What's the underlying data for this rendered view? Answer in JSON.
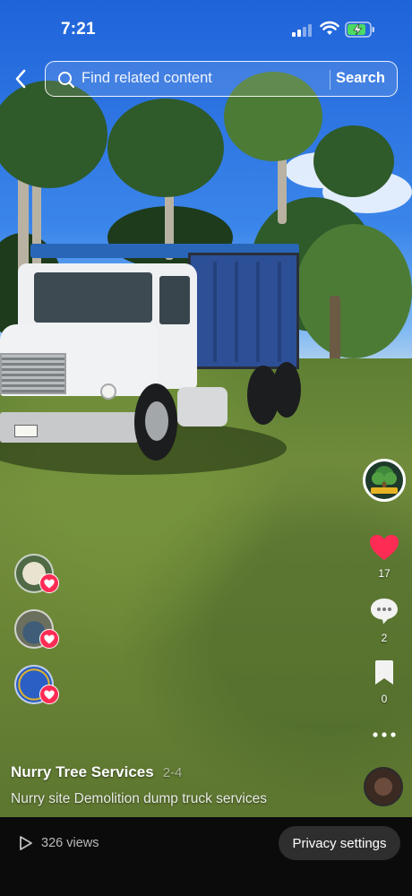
{
  "status_bar": {
    "time": "7:21"
  },
  "search": {
    "placeholder": "Find related content",
    "button_label": "Search"
  },
  "actions": {
    "likes": "17",
    "comments": "2",
    "saves": "0"
  },
  "post": {
    "author": "Nurry Tree Services",
    "date": "2-4",
    "caption": "Nurry site Demolition dump truck services"
  },
  "footer": {
    "views": "326 views",
    "privacy_label": "Privacy settings"
  },
  "colors": {
    "like": "#fe2c55",
    "bottom_bar": "#0b0b0b"
  }
}
